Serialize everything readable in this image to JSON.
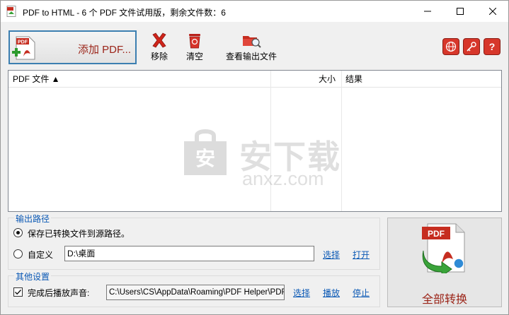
{
  "window": {
    "title": "PDF to HTML - 6 个 PDF 文件试用版，剩余文件数：6"
  },
  "toolbar": {
    "add_pdf_label": "添加 PDF...",
    "remove_label": "移除",
    "clear_label": "清空",
    "view_output_label": "查看输出文件",
    "round_icons": [
      "globe-icon",
      "key-icon",
      "help-icon"
    ]
  },
  "file_list": {
    "columns": {
      "name": "PDF 文件 ▲",
      "size": "大小",
      "result": "结果"
    },
    "rows": [],
    "watermark": {
      "main": "安下载",
      "sub": "anxz.com"
    }
  },
  "output": {
    "legend": "输出路径",
    "save_to_source_label": "保存已转换文件到源路径。",
    "custom_label": "自定义",
    "custom_path": "D:\\桌面",
    "select_link": "选择",
    "open_link": "打开",
    "selected_option": "save_to_source"
  },
  "other": {
    "legend": "其他设置",
    "play_sound_label": "完成后播放声音:",
    "play_sound_checked": true,
    "sound_path": "C:\\Users\\CS\\AppData\\Roaming\\PDF Helper\\PDF",
    "select_link": "选择",
    "play_link": "播放",
    "stop_link": "停止"
  },
  "convert": {
    "label": "全部转换"
  },
  "colors": {
    "accent_blue": "#0b59b5",
    "brand_red": "#9b2418",
    "pdf_red": "#d7372b"
  }
}
